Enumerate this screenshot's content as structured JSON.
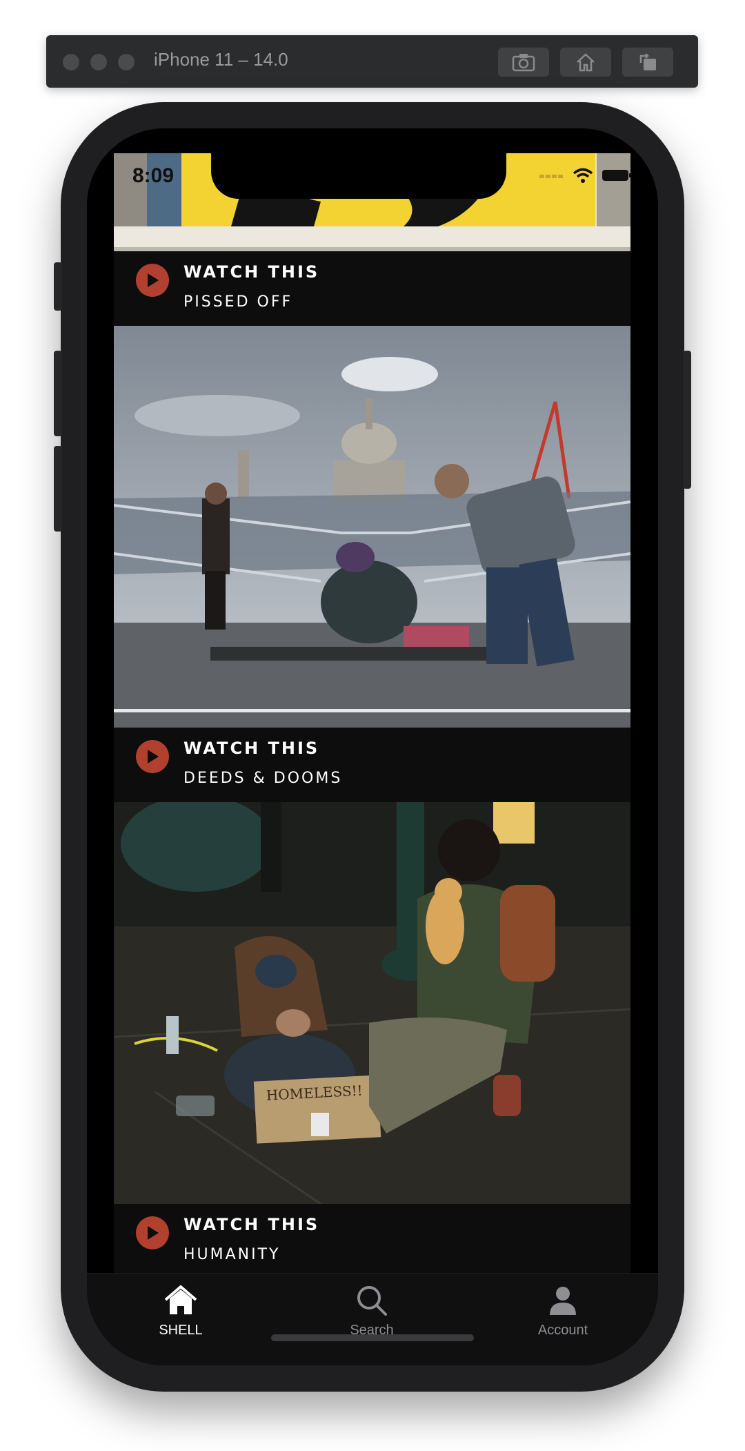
{
  "simulator": {
    "title": "iPhone 11 – 14.0",
    "buttons": [
      "screenshot-icon",
      "home-icon",
      "rotate-icon"
    ]
  },
  "status_bar": {
    "time": "8:09"
  },
  "feed": [
    {
      "label": "WATCH THIS",
      "title": "PISSED OFF",
      "image": "street-art-mural-photo"
    },
    {
      "label": "WATCH THIS",
      "title": "DEEDS & DOOMS",
      "image": "millennium-bridge-st-pauls-photo"
    },
    {
      "label": "WATCH THIS",
      "title": "HUMANITY",
      "image": "homeless-man-and-cat-photo"
    }
  ],
  "tabbar": {
    "items": [
      {
        "label": "SHELL",
        "icon": "home-icon",
        "active": true
      },
      {
        "label": "Search",
        "icon": "search-icon",
        "active": false
      },
      {
        "label": "Account",
        "icon": "person-icon",
        "active": false
      }
    ]
  },
  "colors": {
    "accent": "#b1412e",
    "background": "#0d0d0e",
    "inactive": "#8e8e93"
  }
}
